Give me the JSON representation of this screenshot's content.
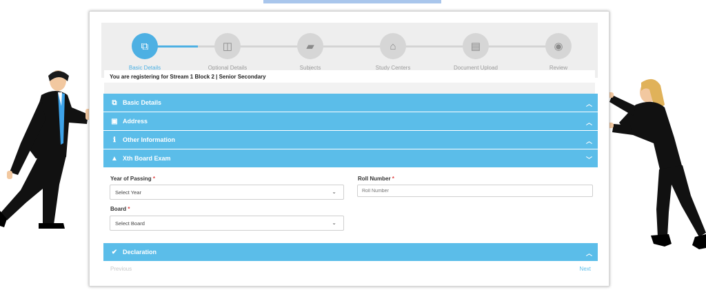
{
  "steps": [
    {
      "label": "Basic Details",
      "icon": "copy-icon",
      "glyph": "⧉",
      "active": true
    },
    {
      "label": "Optional Details",
      "icon": "columns-icon",
      "glyph": "◫",
      "active": false
    },
    {
      "label": "Subjects",
      "icon": "book-icon",
      "glyph": "▰",
      "active": false
    },
    {
      "label": "Study Centers",
      "icon": "bank-icon",
      "glyph": "⌂",
      "active": false
    },
    {
      "label": "Document Upload",
      "icon": "document-icon",
      "glyph": "▤",
      "active": false
    },
    {
      "label": "Review",
      "icon": "eye-icon",
      "glyph": "◉",
      "active": false
    }
  ],
  "notice": "You are registering for Stream 1 Block 2 | Senior Secondary",
  "sections": [
    {
      "title": "Basic Details",
      "icon": "copy-icon",
      "glyph": "⧉",
      "chevron": "up"
    },
    {
      "title": "Address",
      "icon": "id-card-icon",
      "glyph": "▣",
      "chevron": "up"
    },
    {
      "title": "Other Information",
      "icon": "info-icon",
      "glyph": "ℹ",
      "chevron": "up"
    },
    {
      "title": "Xth Board Exam",
      "icon": "graduation-cap-icon",
      "glyph": "🎓",
      "chevron": "down"
    },
    {
      "title": "Declaration",
      "icon": "check-icon",
      "glyph": "✔",
      "chevron": "up"
    }
  ],
  "form": {
    "year_label": "Year of Passing",
    "year_value": "Select Year",
    "roll_label": "Roll Number",
    "roll_placeholder": "Roll Number",
    "board_label": "Board",
    "board_value": "Select Board",
    "required_mark": "*"
  },
  "nav": {
    "previous": "Previous",
    "next": "Next"
  },
  "colors": {
    "accent": "#5bbde9",
    "stepper_bg": "#eeeeee"
  }
}
